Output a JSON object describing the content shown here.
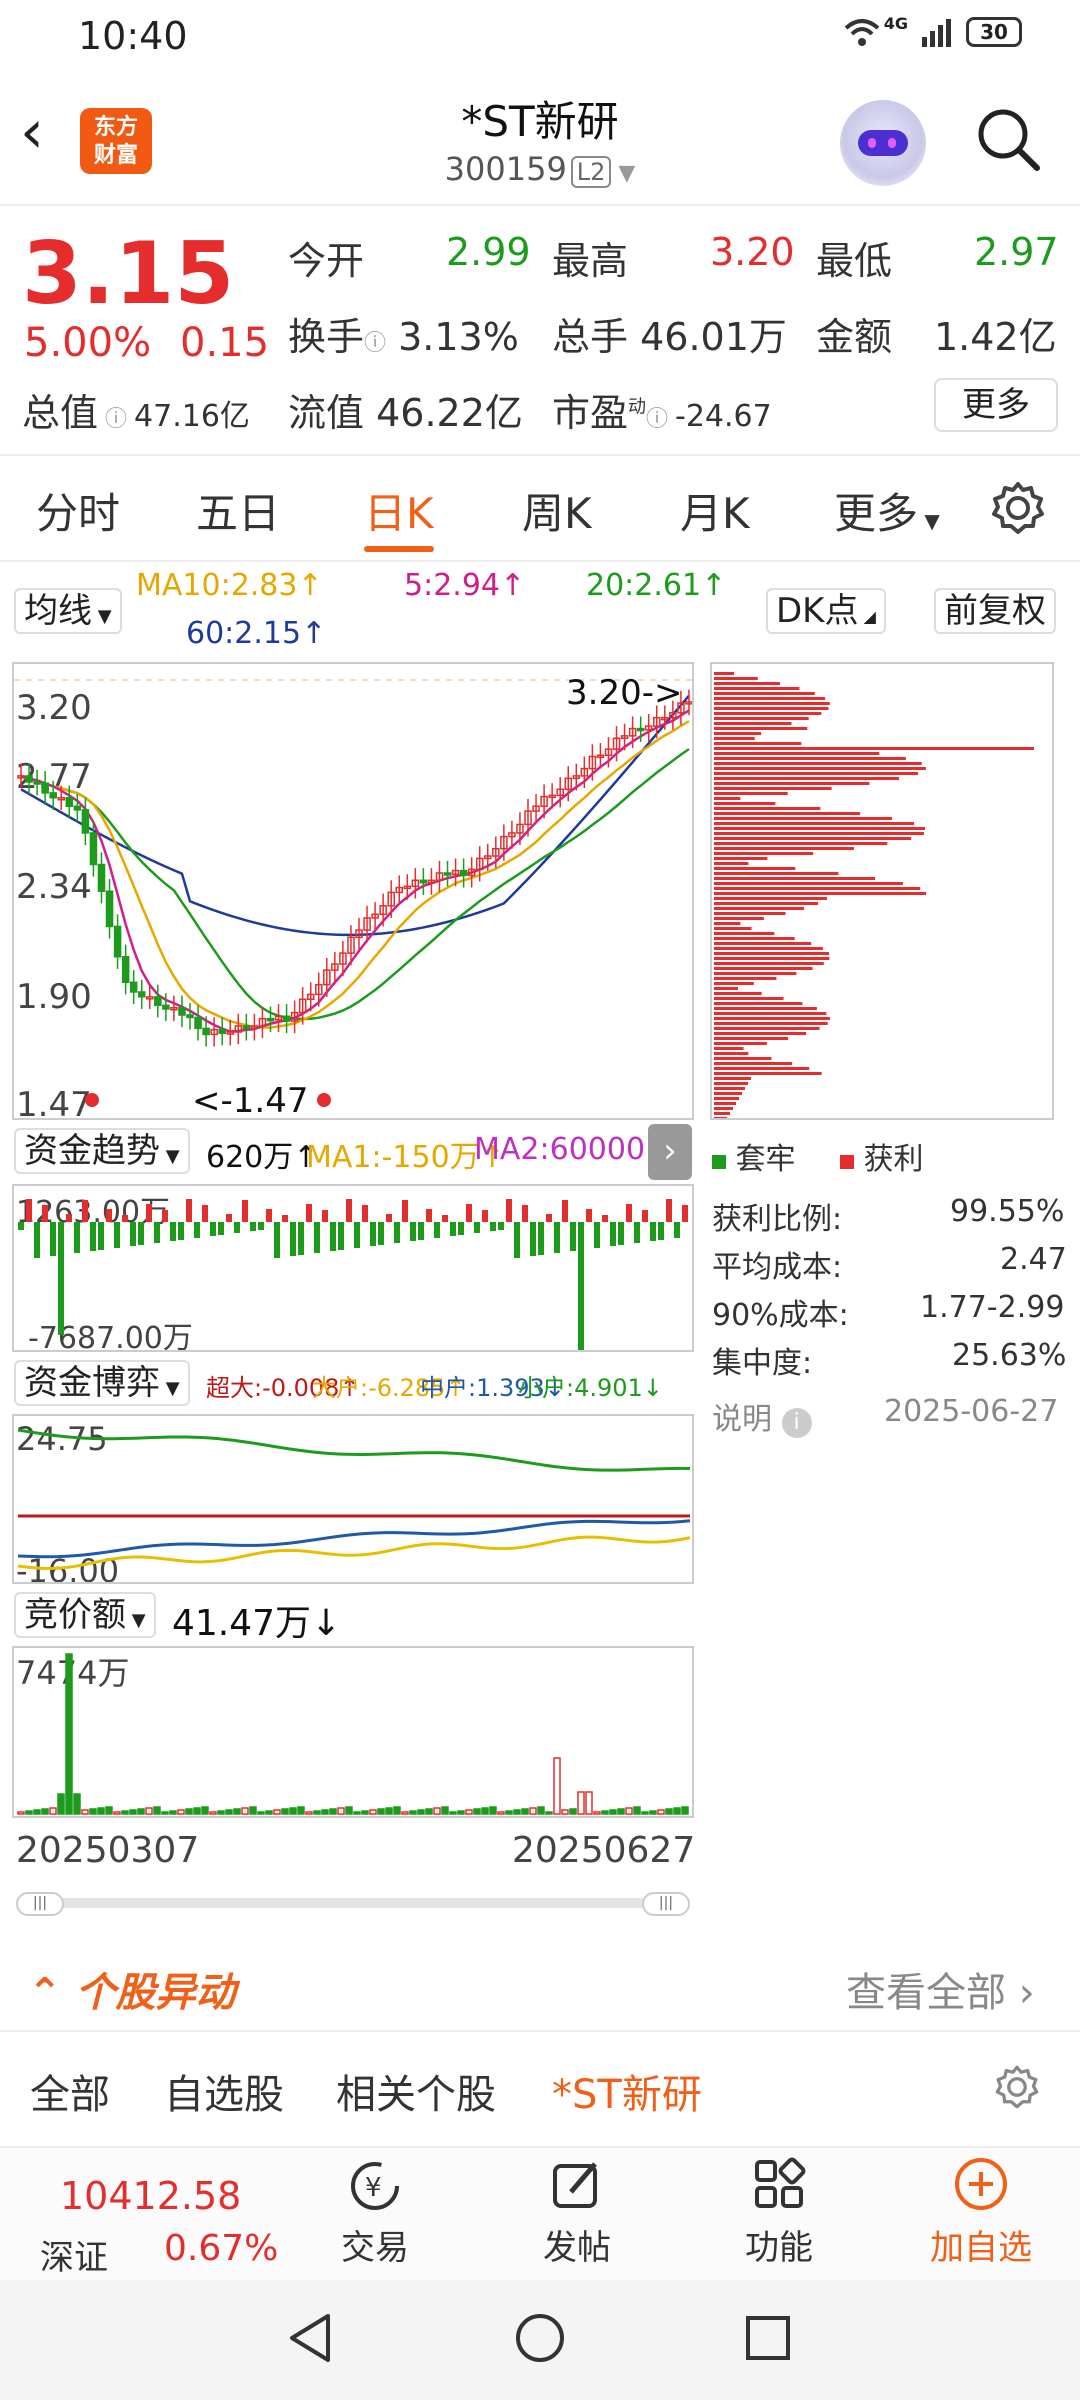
{
  "status": {
    "time": "10:40",
    "signal": "4G",
    "battery": "30"
  },
  "header": {
    "title": "*ST新研",
    "code": "300159",
    "level": "L2",
    "logo_line1": "东方",
    "logo_line2": "财富"
  },
  "quote": {
    "price": "3.15",
    "pct": "5.00%",
    "change": "0.15",
    "open_label": "今开",
    "open": "2.99",
    "high_label": "最高",
    "high": "3.20",
    "low_label": "最低",
    "low": "2.97",
    "turnover_label": "换手",
    "turnover": "3.13%",
    "volume_label": "总手",
    "volume": "46.01万",
    "amount_label": "金额",
    "amount": "1.42亿",
    "mcap_label": "总值",
    "mcap": "47.16亿",
    "float_label": "流值",
    "float": "46.22亿",
    "pe_label": "市盈",
    "pe_sup": "动",
    "pe": "-24.67",
    "more": "更多"
  },
  "tabs": [
    "分时",
    "五日",
    "日K",
    "周K",
    "月K",
    "更多"
  ],
  "chart": {
    "ma_select": "均线",
    "ma10": "MA10:2.83↑",
    "ma5": "5:2.94↑",
    "ma20": "20:2.61↑",
    "ma60": "60:2.15↑",
    "dk": "DK点",
    "fq": "前复权",
    "y_labels": [
      "3.20",
      "2.77",
      "2.34",
      "1.90",
      "1.47"
    ],
    "high_mark": "3.20->",
    "low_mark": "<-1.47",
    "fund_select": "资金趋势",
    "fund_value": "620万↑",
    "fund_ma1": "MA1:-150万↑",
    "fund_ma2": "MA2:60000↑",
    "fund_top": "1263.00万",
    "fund_bottom": "-7687.00万",
    "game_select": "资金博弈",
    "game_super": "超大:-0.008↑",
    "game_big": "大户:-6.285↑",
    "game_mid": "中户:1.393↓",
    "game_small": "小户:4.901↓",
    "game_top": "24.75",
    "game_bottom": "-16.00",
    "auction_select": "竞价额",
    "auction_value": "41.47万↓",
    "auction_top": "7474万",
    "date_start": "20250307",
    "date_end": "20250627"
  },
  "chip": {
    "legend_trap": "套牢",
    "legend_profit": "获利",
    "rows": [
      {
        "label": "获利比例:",
        "value": "99.55%"
      },
      {
        "label": "平均成本:",
        "value": "2.47"
      },
      {
        "label": "90%成本:",
        "value": "1.77-2.99"
      },
      {
        "label": "集中度:",
        "value": "25.63%"
      }
    ],
    "note": "说明",
    "date": "2025-06-27"
  },
  "movement": {
    "title": "个股异动",
    "view_all": "查看全部"
  },
  "filters": [
    "全部",
    "自选股",
    "相关个股",
    "*ST新研"
  ],
  "bottom": {
    "index_value": "10412.58",
    "index_name": "深证",
    "index_pct": "0.67%",
    "trade": "交易",
    "post": "发帖",
    "func": "功能",
    "add": "加自选"
  },
  "colors": {
    "up": "#e52d2d",
    "down": "#1c9b1c",
    "accent": "#f06018"
  }
}
